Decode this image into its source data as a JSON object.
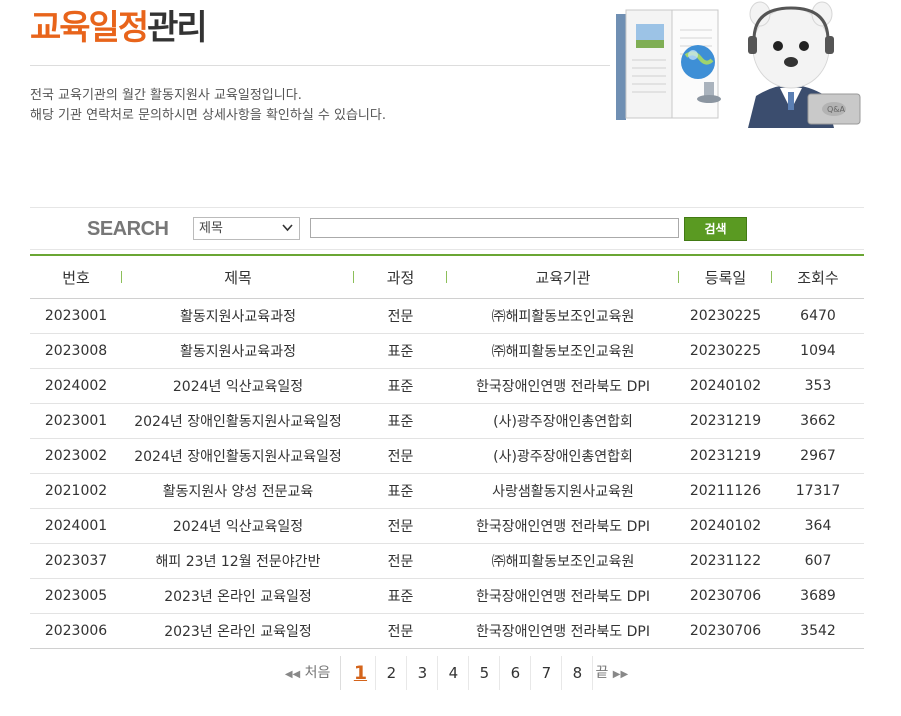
{
  "header": {
    "title_accent": "교육일정",
    "title_rest": "관리",
    "description": [
      "전국 교육기관의 월간 활동지원사 교육일정입니다.",
      "해당 기관 연락처로 문의하시면 상세사항을 확인하실 수 있습니다."
    ]
  },
  "colors": {
    "accent": "#e8641b",
    "green": "#5a9a22",
    "header_rule": "#6aa634"
  },
  "search": {
    "label": "SEARCH",
    "select_value": "제목",
    "input_value": "",
    "button_label": "검색"
  },
  "table": {
    "columns": [
      "번호",
      "제목",
      "과정",
      "교육기관",
      "등록일",
      "조회수"
    ],
    "rows": [
      [
        "2023001",
        "활동지원사교육과정",
        "전문",
        "㈜해피활동보조인교육원",
        "20230225",
        "6470"
      ],
      [
        "2023008",
        "활동지원사교육과정",
        "표준",
        "㈜해피활동보조인교육원",
        "20230225",
        "1094"
      ],
      [
        "2024002",
        "2024년 익산교육일정",
        "표준",
        "한국장애인연맹 전라북도 DPI",
        "20240102",
        "353"
      ],
      [
        "2023001",
        "2024년 장애인활동지원사교육일정",
        "표준",
        "(사)광주장애인총연합회",
        "20231219",
        "3662"
      ],
      [
        "2023002",
        "2024년 장애인활동지원사교육일정",
        "전문",
        "(사)광주장애인총연합회",
        "20231219",
        "2967"
      ],
      [
        "2021002",
        "활동지원사 양성 전문교육",
        "표준",
        "사랑샘활동지원사교육원",
        "20211126",
        "17317"
      ],
      [
        "2024001",
        "2024년 익산교육일정",
        "전문",
        "한국장애인연맹 전라북도 DPI",
        "20240102",
        "364"
      ],
      [
        "2023037",
        "해피 23년 12월 전문야간반",
        "전문",
        "㈜해피활동보조인교육원",
        "20231122",
        "607"
      ],
      [
        "2023005",
        "2023년 온라인 교육일정",
        "표준",
        "한국장애인연맹 전라북도 DPI",
        "20230706",
        "3689"
      ],
      [
        "2023006",
        "2023년 온라인 교육일정",
        "전문",
        "한국장애인연맹 전라북도 DPI",
        "20230706",
        "3542"
      ]
    ]
  },
  "pagination": {
    "first_label": "처음",
    "last_label": "끝",
    "pages": [
      "1",
      "2",
      "3",
      "4",
      "5",
      "6",
      "7",
      "8"
    ],
    "current": "1"
  },
  "icons": {
    "first": "double-chevron-left-icon",
    "last": "double-chevron-right-icon",
    "select": "chevron-down-icon",
    "hero": "qa-mascot-illustration"
  }
}
